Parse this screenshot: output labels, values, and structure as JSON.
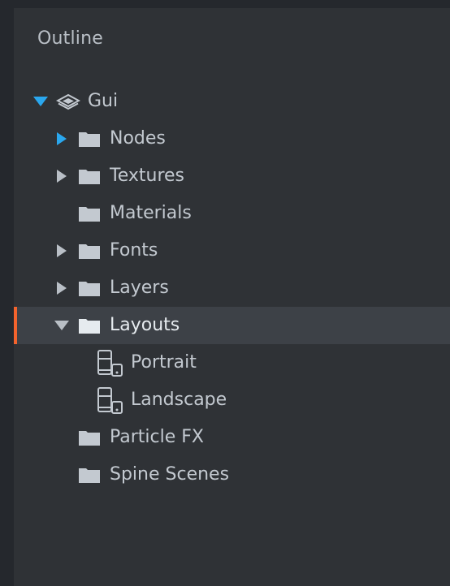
{
  "panel": {
    "title": "Outline"
  },
  "colors": {
    "background": "#25282d",
    "panel": "#2f3236",
    "selected_row": "#3d4147",
    "selected_accent": "#f3632d",
    "expander_active": "#2aa7ee",
    "text": "#c3c9d0"
  },
  "tree": {
    "root": {
      "label": "Gui",
      "icon": "gui-layers-icon",
      "expanded": true
    },
    "nodes": {
      "label": "Nodes",
      "icon": "folder-icon",
      "expanded": false
    },
    "textures": {
      "label": "Textures",
      "icon": "folder-icon",
      "expanded": false
    },
    "materials": {
      "label": "Materials",
      "icon": "folder-icon"
    },
    "fonts": {
      "label": "Fonts",
      "icon": "folder-icon",
      "expanded": false
    },
    "layers": {
      "label": "Layers",
      "icon": "folder-icon",
      "expanded": false
    },
    "layouts": {
      "label": "Layouts",
      "icon": "folder-icon",
      "expanded": true,
      "selected": true
    },
    "portrait": {
      "label": "Portrait",
      "icon": "device-layout-icon"
    },
    "landscape": {
      "label": "Landscape",
      "icon": "device-layout-icon"
    },
    "particle_fx": {
      "label": "Particle FX",
      "icon": "folder-icon"
    },
    "spine_scenes": {
      "label": "Spine Scenes",
      "icon": "folder-icon"
    }
  }
}
